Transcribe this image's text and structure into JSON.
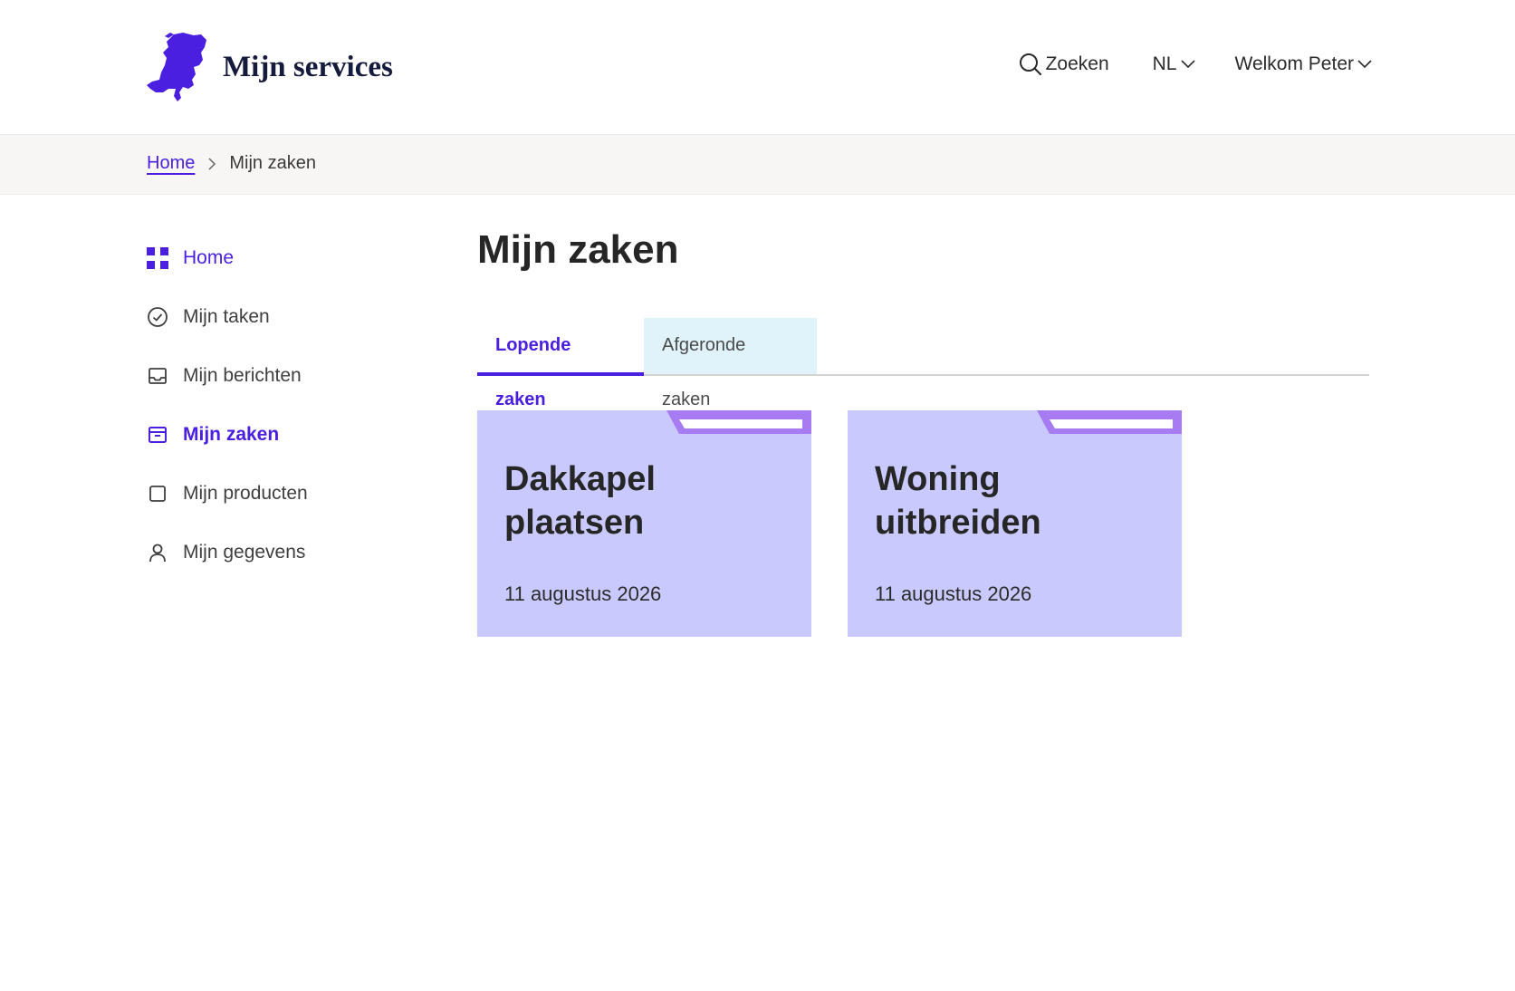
{
  "header": {
    "site_title": "Mijn services",
    "search_label": "Zoeken",
    "language_label": "NL",
    "user_label": "Welkom Peter"
  },
  "breadcrumb": {
    "home": "Home",
    "current": "Mijn zaken"
  },
  "sidebar": {
    "items": [
      {
        "label": "Home",
        "icon": "grid-icon"
      },
      {
        "label": "Mijn taken",
        "icon": "check-circle-icon"
      },
      {
        "label": "Mijn berichten",
        "icon": "inbox-icon"
      },
      {
        "label": "Mijn zaken",
        "icon": "archive-icon"
      },
      {
        "label": "Mijn producten",
        "icon": "square-icon"
      },
      {
        "label": "Mijn gegevens",
        "icon": "user-icon"
      }
    ]
  },
  "main": {
    "title": "Mijn zaken",
    "tabs": [
      {
        "label": "Lopende zaken",
        "active": true
      },
      {
        "label": "Afgeronde zaken",
        "active": false
      }
    ],
    "cards": [
      {
        "title": "Dakkapel plaatsen",
        "date": "11 augustus 2026"
      },
      {
        "title": "Woning uitbreiden",
        "date": "11 augustus 2026"
      }
    ]
  },
  "colors": {
    "accent": "#4b1fe0",
    "card_bg": "#c9c9fd",
    "card_tab": "#a77cf3",
    "inactive_tab_bg": "#e0f2fa"
  }
}
